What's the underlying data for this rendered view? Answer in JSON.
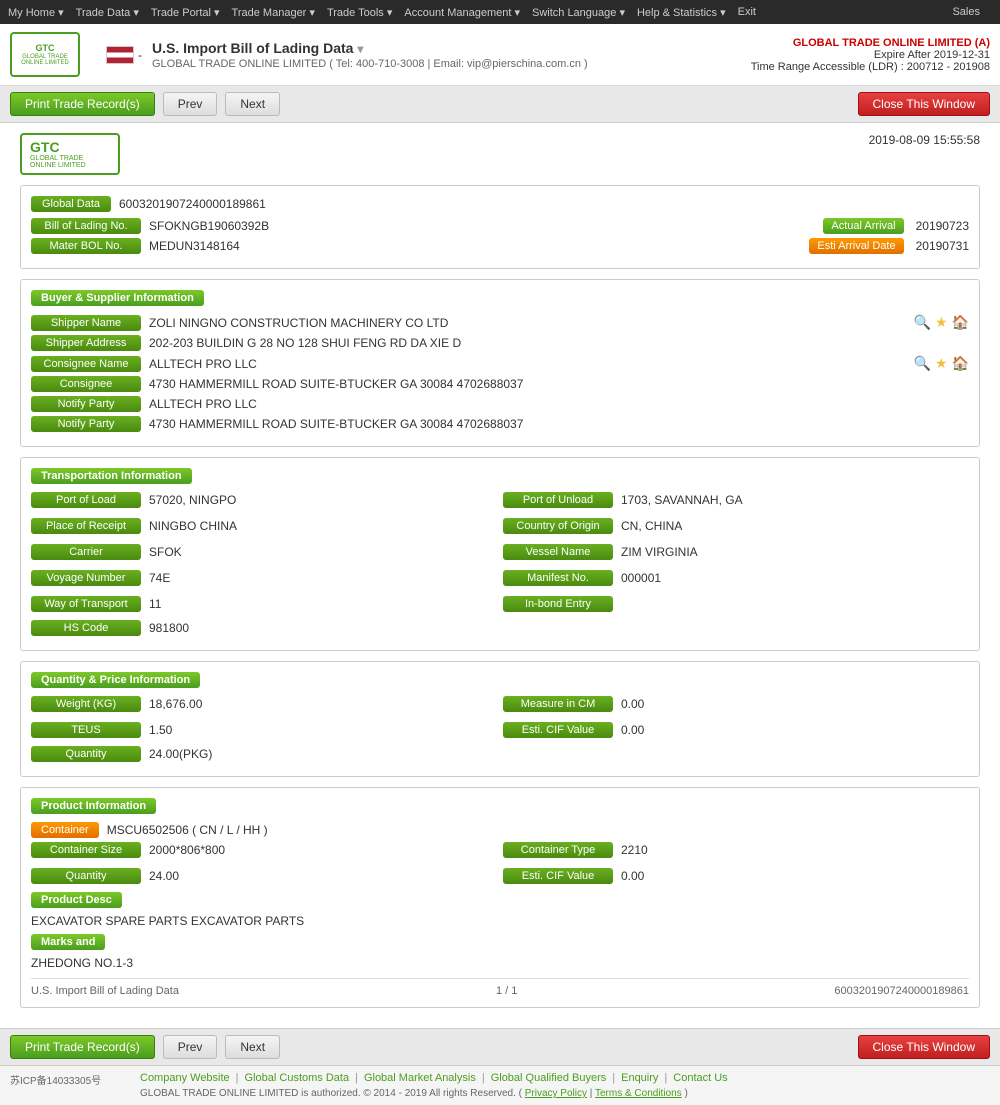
{
  "nav": {
    "items": [
      "My Home",
      "Trade Data",
      "Trade Portal",
      "Trade Manager",
      "Trade Tools",
      "Account Management",
      "Switch Language",
      "Help & Statistics",
      "Exit"
    ],
    "sales": "Sales"
  },
  "header": {
    "logo_line1": "GTC",
    "logo_line2": "GLOBAL TRADE ONLINE LIMITED",
    "flag_alt": "US Flag",
    "title": "U.S. Import Bill of Lading Data",
    "subtitle_tel": "GLOBAL TRADE ONLINE LIMITED ( Tel: 400-710-3008 | Email: vip@pierschina.com.cn )",
    "company": "GLOBAL TRADE ONLINE LIMITED (A)",
    "expire": "Expire After 2019-12-31",
    "time_range": "Time Range Accessible (LDR) : 200712 - 201908"
  },
  "toolbar": {
    "print_label": "Print Trade Record(s)",
    "prev_label": "Prev",
    "next_label": "Next",
    "close_label": "Close This Window"
  },
  "doc": {
    "timestamp": "2019-08-09 15:55:58",
    "global_data_label": "Global Data",
    "global_data_value": "6003201907240000189861",
    "bol_no_label": "Bill of Lading No.",
    "bol_no_value": "SFOKNGB19060392B",
    "actual_arrival_label": "Actual Arrival",
    "actual_arrival_value": "20190723",
    "mater_bol_label": "Mater BOL No.",
    "mater_bol_value": "MEDUN3148164",
    "esti_arrival_label": "Esti Arrival Date",
    "esti_arrival_value": "20190731"
  },
  "buyer_supplier": {
    "section_title": "Buyer & Supplier Information",
    "shipper_name_label": "Shipper Name",
    "shipper_name_value": "ZOLI NINGNO CONSTRUCTION MACHINERY CO LTD",
    "shipper_address_label": "Shipper Address",
    "shipper_address_value": "202-203 BUILDIN G 28 NO 128 SHUI FENG RD DA XIE D",
    "consignee_name_label": "Consignee Name",
    "consignee_name_value": "ALLTECH PRO LLC",
    "consignee_label": "Consignee",
    "consignee_value": "4730 HAMMERMILL ROAD SUITE-BTUCKER GA 30084 4702688037",
    "notify_party_label": "Notify Party",
    "notify_party_value": "ALLTECH PRO LLC",
    "notify_party2_label": "Notify Party",
    "notify_party2_value": "4730 HAMMERMILL ROAD SUITE-BTUCKER GA 30084 4702688037"
  },
  "transport": {
    "section_title": "Transportation Information",
    "port_load_label": "Port of Load",
    "port_load_value": "57020, NINGPO",
    "port_unload_label": "Port of Unload",
    "port_unload_value": "1703, SAVANNAH, GA",
    "place_receipt_label": "Place of Receipt",
    "place_receipt_value": "NINGBO CHINA",
    "country_origin_label": "Country of Origin",
    "country_origin_value": "CN, CHINA",
    "carrier_label": "Carrier",
    "carrier_value": "SFOK",
    "vessel_name_label": "Vessel Name",
    "vessel_name_value": "ZIM VIRGINIA",
    "voyage_label": "Voyage Number",
    "voyage_value": "74E",
    "manifest_label": "Manifest No.",
    "manifest_value": "000001",
    "way_transport_label": "Way of Transport",
    "way_transport_value": "11",
    "inbond_label": "In-bond Entry",
    "inbond_value": "",
    "hs_code_label": "HS Code",
    "hs_code_value": "981800"
  },
  "quantity": {
    "section_title": "Quantity & Price Information",
    "weight_label": "Weight (KG)",
    "weight_value": "18,676.00",
    "measure_label": "Measure in CM",
    "measure_value": "0.00",
    "teus_label": "TEUS",
    "teus_value": "1.50",
    "esti_cif_label": "Esti. CIF Value",
    "esti_cif_value": "0.00",
    "quantity_label": "Quantity",
    "quantity_value": "24.00(PKG)"
  },
  "product": {
    "section_title": "Product Information",
    "container_label": "Container",
    "container_value": "MSCU6502506 ( CN / L / HH )",
    "container_size_label": "Container Size",
    "container_size_value": "2000*806*800",
    "container_type_label": "Container Type",
    "container_type_value": "2210",
    "quantity_label": "Quantity",
    "quantity_value": "24.00",
    "esti_cif_label": "Esti. CIF Value",
    "esti_cif_value": "0.00",
    "product_desc_title": "Product Desc",
    "product_desc_value": "EXCAVATOR SPARE PARTS EXCAVATOR PARTS",
    "marks_title": "Marks and",
    "marks_value": "ZHEDONG NO.1-3"
  },
  "record_footer": {
    "label": "U.S. Import Bill of Lading Data",
    "page": "1 / 1",
    "id": "6003201907240000189861"
  },
  "footer": {
    "icp": "苏ICP备14033305号",
    "links": [
      "Company Website",
      "Global Customs Data",
      "Global Market Analysis",
      "Global Qualified Buyers",
      "Enquiry",
      "Contact Us"
    ],
    "copy": "GLOBAL TRADE ONLINE LIMITED is authorized. © 2014 - 2019 All rights Reserved.  (",
    "privacy": "Privacy Policy",
    "separator": "|",
    "terms": "Terms & Conditions",
    "copy_end": ")"
  }
}
